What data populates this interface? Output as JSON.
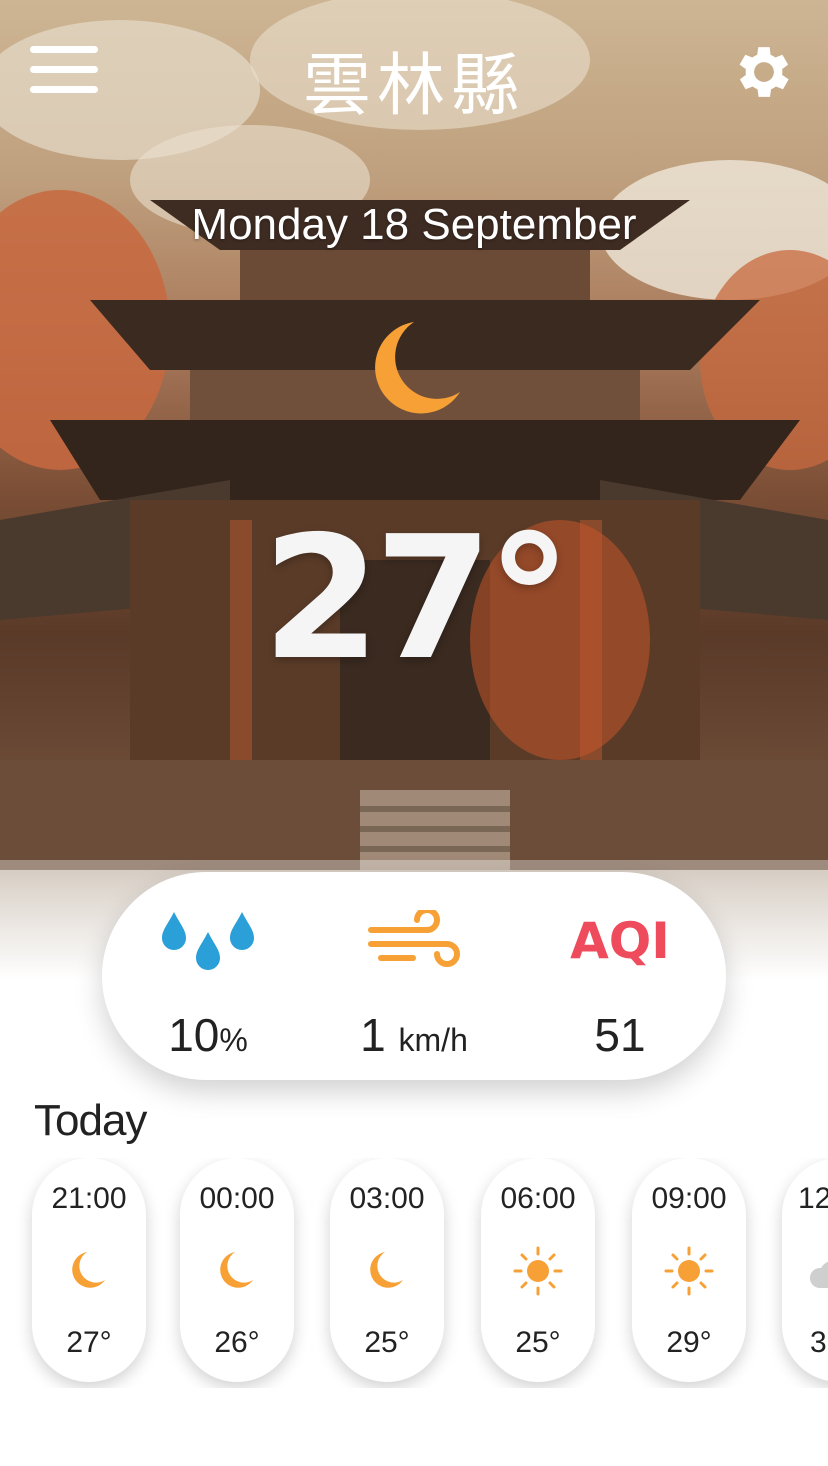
{
  "header": {
    "city": "雲林縣",
    "date": "Monday 18 September"
  },
  "current": {
    "temperature": "27°",
    "icon": "moon-icon"
  },
  "stats": {
    "precipitation": {
      "value": "10",
      "unit": "%",
      "icon": "raindrops-icon"
    },
    "wind": {
      "value": "1",
      "unit": "km/h",
      "icon": "wind-icon"
    },
    "aqi": {
      "label": "AQI",
      "value": "51"
    }
  },
  "today_label": "Today",
  "hourly": [
    {
      "time": "21:00",
      "icon": "moon-icon",
      "temp": "27°"
    },
    {
      "time": "00:00",
      "icon": "moon-icon",
      "temp": "26°"
    },
    {
      "time": "03:00",
      "icon": "moon-icon",
      "temp": "25°"
    },
    {
      "time": "06:00",
      "icon": "sun-icon",
      "temp": "25°"
    },
    {
      "time": "09:00",
      "icon": "sun-icon",
      "temp": "29°"
    },
    {
      "time": "12",
      "icon": "cloud-icon",
      "temp": "3"
    }
  ],
  "colors": {
    "accent_orange": "#f7a035",
    "rain_blue": "#2a9fd8",
    "aqi_red": "#ee4b5c",
    "text_dark": "#222222"
  }
}
